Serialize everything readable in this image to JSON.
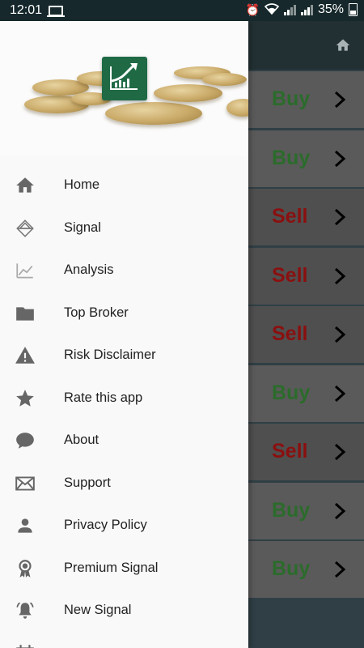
{
  "status_bar": {
    "time": "12:01",
    "battery": "35%"
  },
  "menu": {
    "items": [
      {
        "label": "Home",
        "icon": "home-icon"
      },
      {
        "label": "Signal",
        "icon": "signal-icon"
      },
      {
        "label": "Analysis",
        "icon": "analysis-chart-icon"
      },
      {
        "label": "Top Broker",
        "icon": "folder-icon"
      },
      {
        "label": "Risk Disclaimer",
        "icon": "warning-icon"
      },
      {
        "label": "Rate this app",
        "icon": "star-icon"
      },
      {
        "label": "About",
        "icon": "chat-bubble-icon"
      },
      {
        "label": "Support",
        "icon": "mail-icon"
      },
      {
        "label": "Privacy Policy",
        "icon": "person-icon"
      },
      {
        "label": "Premium Signal",
        "icon": "award-icon"
      },
      {
        "label": "New Signal",
        "icon": "bell-icon"
      },
      {
        "label": "",
        "icon": "calendar-icon"
      }
    ]
  },
  "signals": [
    {
      "action": "Buy",
      "type": "buy"
    },
    {
      "action": "Buy",
      "type": "buy"
    },
    {
      "action": "Sell",
      "type": "sell"
    },
    {
      "action": "Sell",
      "type": "sell"
    },
    {
      "action": "Sell",
      "type": "sell"
    },
    {
      "action": "Buy",
      "type": "buy"
    },
    {
      "action": "Sell",
      "type": "sell"
    },
    {
      "action": "Buy",
      "type": "buy"
    },
    {
      "action": "Buy",
      "type": "buy"
    }
  ],
  "colors": {
    "buy": "#2b6b2b",
    "sell": "#8a1010",
    "status_bar": "#16282b",
    "logo": "#1f6a45"
  }
}
